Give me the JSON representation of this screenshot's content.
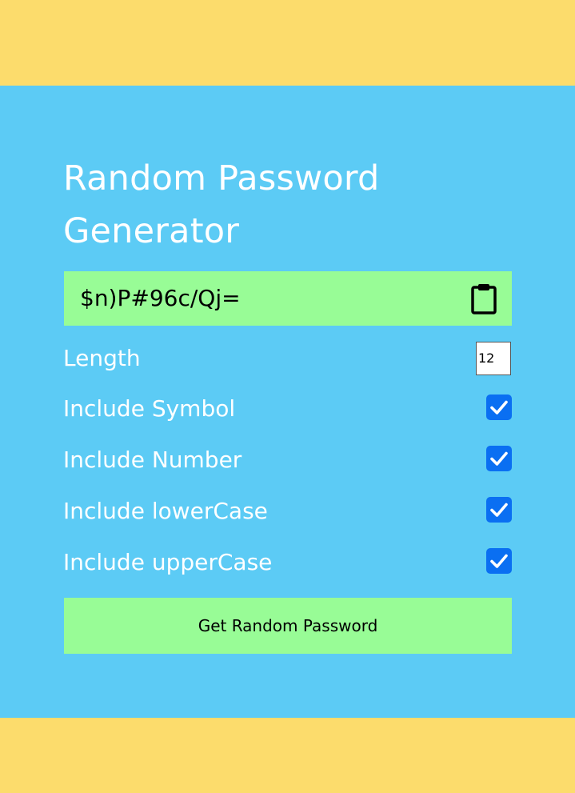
{
  "app": {
    "title": "Random Password Generator"
  },
  "result": {
    "password": "$n)P#96c/Qj=",
    "copy_icon": "clipboard-icon"
  },
  "options": {
    "length_label": "Length",
    "length_value": "12",
    "items": [
      {
        "label": "Include Symbol",
        "checked": true
      },
      {
        "label": "Include Number",
        "checked": true
      },
      {
        "label": "Include lowerCase",
        "checked": true
      },
      {
        "label": "Include upperCase",
        "checked": true
      }
    ]
  },
  "actions": {
    "generate_label": "Get Random Password"
  },
  "colors": {
    "page_bg": "#fcdc6c",
    "panel_bg": "#5ccbf5",
    "box_bg": "#98fc96",
    "check_bg": "#0a6ff2"
  }
}
